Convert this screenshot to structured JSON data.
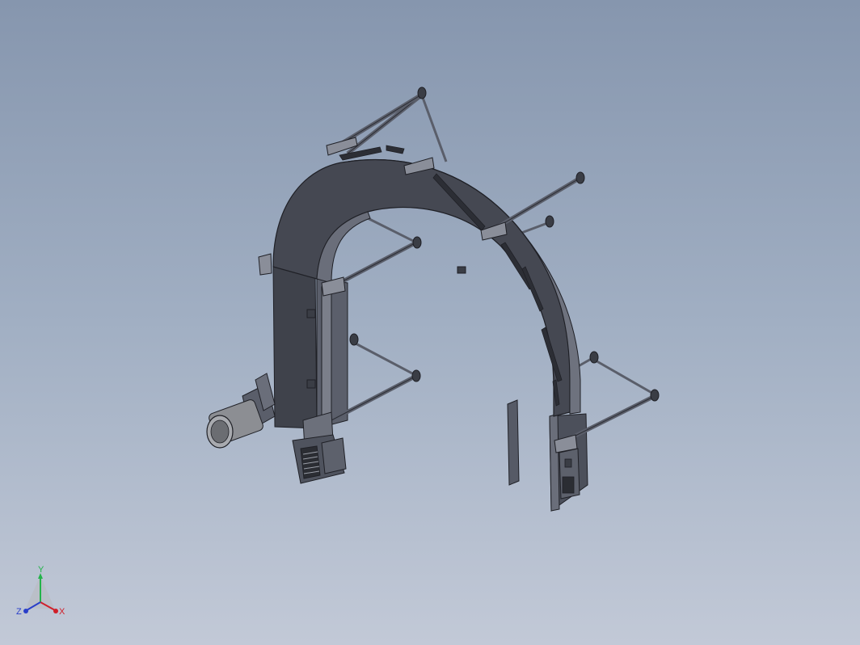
{
  "viewport": {
    "background_top": "#8696ae",
    "background_bottom": "#c2c9d7",
    "model_face": "#454852",
    "model_edge": "#1f2026",
    "model_light": "#6d717d"
  },
  "triad": {
    "x_label": "X",
    "y_label": "Y",
    "z_label": "Z",
    "x_color": "#d0202a",
    "y_color": "#23b34a",
    "z_color": "#2a3fc9"
  }
}
